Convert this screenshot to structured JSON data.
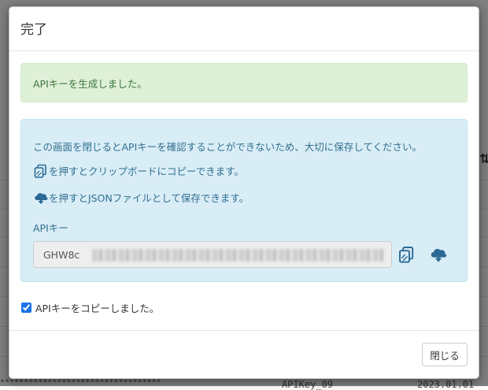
{
  "modal": {
    "title": "完了",
    "success_message": "APIキーを生成しました。",
    "info": {
      "warning_text": "この画面を閉じるとAPIキーを確認することができないため、大切に保存してください。",
      "copy_hint": "を押すとクリップボードにコピーできます。",
      "download_hint": "を押すとJSONファイルとして保存できます。",
      "apikey_label": "APIキー",
      "apikey_value_visible": "GHW8c"
    },
    "copied_checkbox": {
      "label": "APIキーをコピーしました。",
      "checked": true
    },
    "close_label": "閉じる"
  },
  "background": {
    "row_key_name": "APIKey_09",
    "row_date": "2023.01.01",
    "masked": "**********************************"
  },
  "colors": {
    "success_bg": "#dff0d8",
    "success_text": "#3c763d",
    "info_bg": "#d9edf7",
    "info_text": "#31708f",
    "icon": "#2b6a94"
  },
  "icons": [
    "copy-icon",
    "cloud-download-icon",
    "sort-icon"
  ]
}
